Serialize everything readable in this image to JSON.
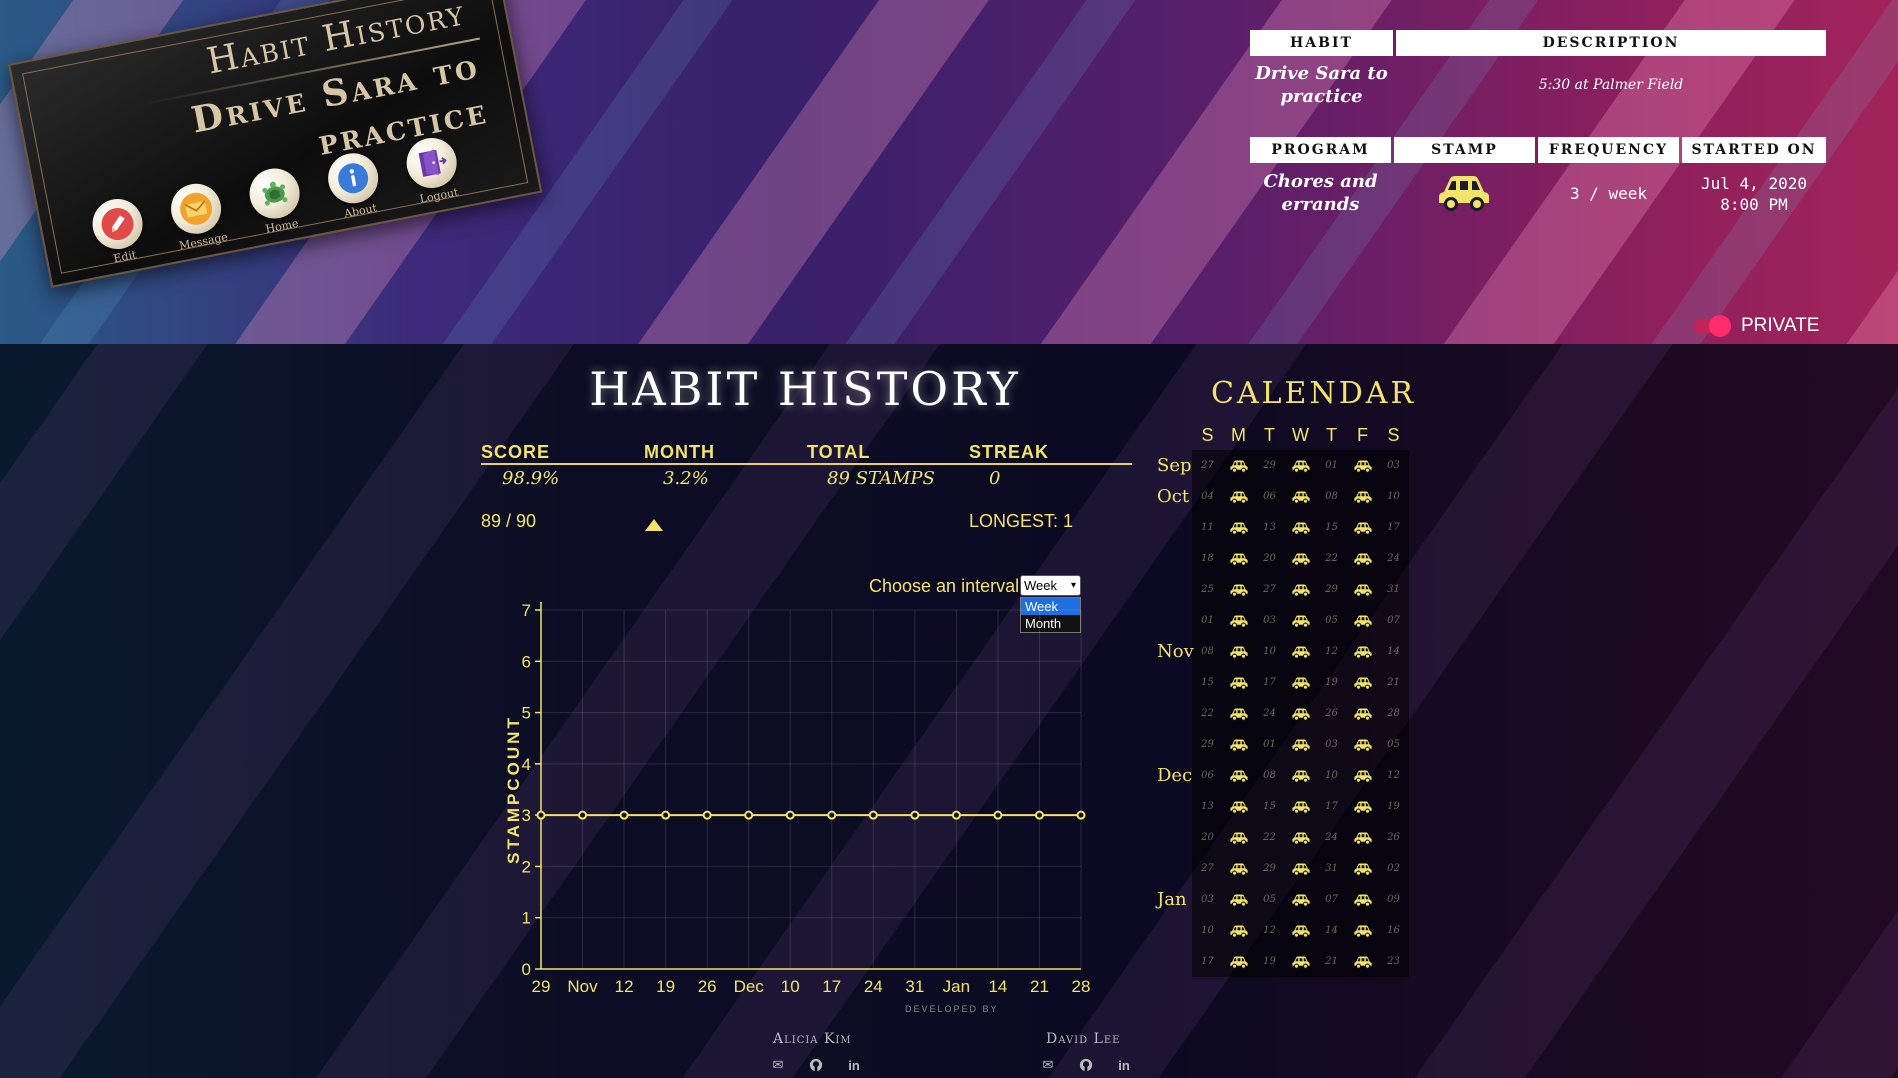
{
  "card": {
    "title": "Habit History",
    "habit": "Drive Sara to practice",
    "nav": [
      {
        "label": "Edit",
        "icon": "pencil-icon"
      },
      {
        "label": "Message",
        "icon": "envelope-icon"
      },
      {
        "label": "Home",
        "icon": "turtle-icon"
      },
      {
        "label": "About",
        "icon": "info-icon"
      },
      {
        "label": "Logout",
        "icon": "door-exit-icon"
      }
    ]
  },
  "info": {
    "habit_header": "HABIT",
    "description_header": "DESCRIPTION",
    "habit_value": "Drive Sara to practice",
    "description_value": "5:30 at Palmer Field",
    "program_header": "PROGRAM",
    "stamp_header": "STAMP",
    "frequency_header": "FREQUENCY",
    "started_header": "STARTED ON",
    "program_value": "Chores and errands",
    "stamp_icon": "car-icon",
    "frequency_value": "3 / week",
    "started_date": "Jul 4, 2020",
    "started_time": "8:00 PM"
  },
  "privacy": {
    "label": "PRIVATE",
    "enabled": true
  },
  "main": {
    "title": "HABIT HISTORY",
    "stats": {
      "score_label": "SCORE",
      "score_value": "98.9%",
      "score_fraction": "89 / 90",
      "month_label": "MONTH",
      "month_value": "3.2%",
      "total_label": "TOTAL",
      "total_value": "89 STAMPS",
      "streak_label": "STREAK",
      "streak_value": "0",
      "longest": "LONGEST: 1"
    }
  },
  "interval": {
    "label": "Choose an interval",
    "selected": "Week",
    "options": [
      "Week",
      "Month"
    ]
  },
  "chart_data": {
    "type": "line",
    "title": "",
    "xlabel": "",
    "ylabel": "STAMPCOUNT",
    "categories": [
      "29",
      "Nov",
      "12",
      "19",
      "26",
      "Dec",
      "10",
      "17",
      "24",
      "31",
      "Jan",
      "14",
      "21",
      "28"
    ],
    "x": [
      "2020-10-29",
      "2020-11-05",
      "2020-11-12",
      "2020-11-19",
      "2020-11-26",
      "2020-12-03",
      "2020-12-10",
      "2020-12-17",
      "2020-12-24",
      "2020-12-31",
      "2021-01-07",
      "2021-01-14",
      "2021-01-21",
      "2021-01-28"
    ],
    "series": [
      {
        "values": [
          3,
          3,
          3,
          3,
          3,
          3,
          3,
          3,
          3,
          3,
          3,
          3,
          3,
          3
        ]
      }
    ],
    "ylim": [
      0,
      7
    ],
    "yticks": [
      0,
      1,
      2,
      3,
      4,
      5,
      6,
      7
    ],
    "grid": true,
    "color": "#f3e36a"
  },
  "calendar": {
    "title": "CALENDAR",
    "day_headers": [
      "S",
      "M",
      "T",
      "W",
      "T",
      "F",
      "S"
    ],
    "stamp_icon": "car-icon",
    "stamp_color": "#f3e36a",
    "rows": [
      {
        "month": "Sep",
        "days": [
          "27",
          "28",
          "29",
          "30",
          "01",
          "02",
          "03"
        ]
      },
      {
        "month": "Oct",
        "days": [
          "04",
          "05",
          "06",
          "07",
          "08",
          "09",
          "10"
        ]
      },
      {
        "month": "",
        "days": [
          "11",
          "12",
          "13",
          "14",
          "15",
          "16",
          "17"
        ]
      },
      {
        "month": "",
        "days": [
          "18",
          "19",
          "20",
          "21",
          "22",
          "23",
          "24"
        ]
      },
      {
        "month": "",
        "days": [
          "25",
          "26",
          "27",
          "28",
          "29",
          "30",
          "31"
        ]
      },
      {
        "month": "",
        "days": [
          "01",
          "02",
          "03",
          "04",
          "05",
          "06",
          "07"
        ]
      },
      {
        "month": "Nov",
        "days": [
          "08",
          "09",
          "10",
          "11",
          "12",
          "13",
          "14"
        ]
      },
      {
        "month": "",
        "days": [
          "15",
          "16",
          "17",
          "18",
          "19",
          "20",
          "21"
        ]
      },
      {
        "month": "",
        "days": [
          "22",
          "23",
          "24",
          "25",
          "26",
          "27",
          "28"
        ]
      },
      {
        "month": "",
        "days": [
          "29",
          "30",
          "01",
          "02",
          "03",
          "04",
          "05"
        ]
      },
      {
        "month": "Dec",
        "days": [
          "06",
          "07",
          "08",
          "09",
          "10",
          "11",
          "12"
        ]
      },
      {
        "month": "",
        "days": [
          "13",
          "14",
          "15",
          "16",
          "17",
          "18",
          "19"
        ]
      },
      {
        "month": "",
        "days": [
          "20",
          "21",
          "22",
          "23",
          "24",
          "25",
          "26"
        ]
      },
      {
        "month": "",
        "days": [
          "27",
          "28",
          "29",
          "30",
          "31",
          "01",
          "02"
        ]
      },
      {
        "month": "Jan",
        "days": [
          "03",
          "04",
          "05",
          "06",
          "07",
          "08",
          "09"
        ]
      },
      {
        "month": "",
        "days": [
          "10",
          "11",
          "12",
          "13",
          "14",
          "15",
          "16"
        ]
      },
      {
        "month": "",
        "days": [
          "17",
          "18",
          "19",
          "20",
          "21",
          "22",
          "23"
        ]
      }
    ],
    "stamped_columns": [
      1,
      3,
      5
    ]
  },
  "footer": {
    "developed_by": "DEVELOPED BY",
    "developers": [
      {
        "name": "Alicia Kim",
        "icons": [
          "envelope-icon",
          "github-icon",
          "linkedin-icon"
        ]
      },
      {
        "name": "David Lee",
        "icons": [
          "envelope-icon",
          "github-icon",
          "linkedin-icon"
        ]
      }
    ]
  }
}
